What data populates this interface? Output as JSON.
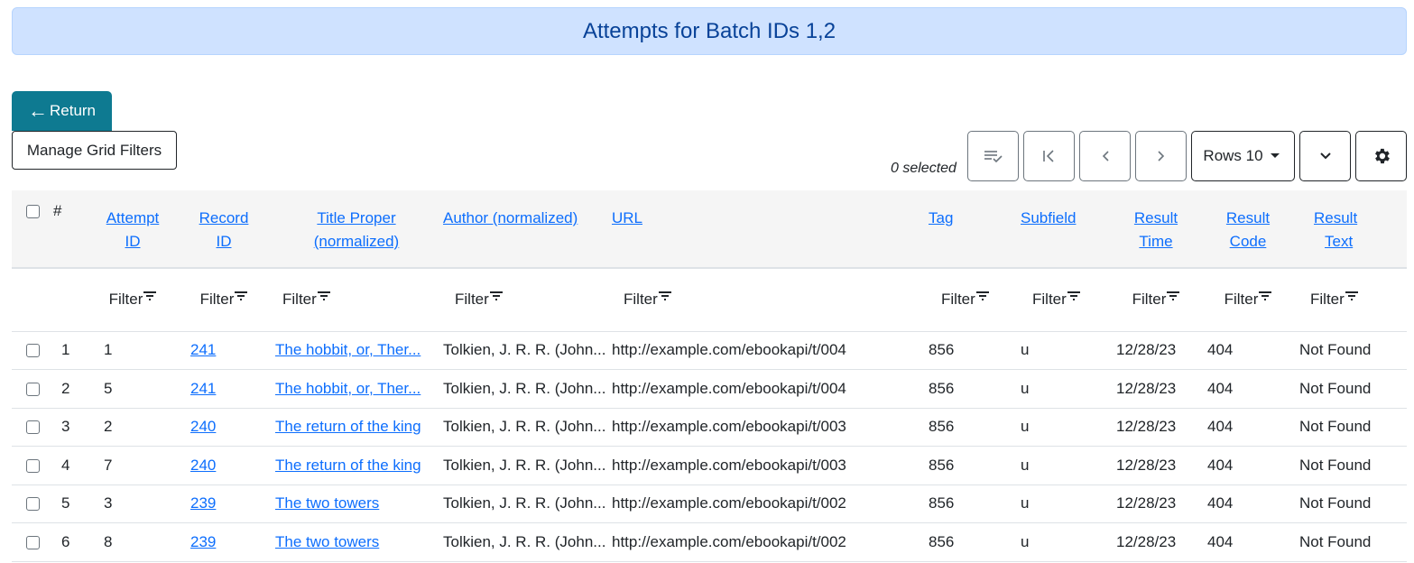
{
  "banner": {
    "title": "Attempts for Batch IDs 1,2"
  },
  "buttons": {
    "return_label": "Return",
    "return_icon": "←",
    "manage_filters_label": "Manage Grid Filters"
  },
  "toolbar": {
    "selected_text": "0 selected",
    "rows_label": "Rows 10",
    "icons": [
      "select-list-icon",
      "first-page-icon",
      "previous-page-icon",
      "next-page-icon",
      "caret-down-icon",
      "chevron-down-icon",
      "gear-icon"
    ]
  },
  "grid": {
    "hash_header": "#",
    "columns": [
      {
        "line1": "Attempt",
        "line2": "ID"
      },
      {
        "line1": "Record",
        "line2": "ID"
      },
      {
        "line1": "Title Proper",
        "line2": "(normalized)"
      },
      {
        "line1": "Author (normalized)",
        "line2": ""
      },
      {
        "line1": "URL",
        "line2": ""
      },
      {
        "line1": "Tag",
        "line2": ""
      },
      {
        "line1": "Subfield",
        "line2": ""
      },
      {
        "line1": "Result",
        "line2": "Time"
      },
      {
        "line1": "Result",
        "line2": "Code"
      },
      {
        "line1": "Result",
        "line2": "Text"
      }
    ],
    "filter_label": "Filter",
    "rows": [
      {
        "num": "1",
        "attempt_id": "1",
        "record_id": "241",
        "title": "The hobbit, or, Ther...",
        "author": "Tolkien, J. R. R. (John...",
        "url": "http://example.com/ebookapi/t/004",
        "tag": "856",
        "subfield": "u",
        "result_time": "12/28/23",
        "result_code": "404",
        "result_text": "Not Found"
      },
      {
        "num": "2",
        "attempt_id": "5",
        "record_id": "241",
        "title": "The hobbit, or, Ther...",
        "author": "Tolkien, J. R. R. (John...",
        "url": "http://example.com/ebookapi/t/004",
        "tag": "856",
        "subfield": "u",
        "result_time": "12/28/23",
        "result_code": "404",
        "result_text": "Not Found"
      },
      {
        "num": "3",
        "attempt_id": "2",
        "record_id": "240",
        "title": "The return of the king",
        "author": "Tolkien, J. R. R. (John...",
        "url": "http://example.com/ebookapi/t/003",
        "tag": "856",
        "subfield": "u",
        "result_time": "12/28/23",
        "result_code": "404",
        "result_text": "Not Found"
      },
      {
        "num": "4",
        "attempt_id": "7",
        "record_id": "240",
        "title": "The return of the king",
        "author": "Tolkien, J. R. R. (John...",
        "url": "http://example.com/ebookapi/t/003",
        "tag": "856",
        "subfield": "u",
        "result_time": "12/28/23",
        "result_code": "404",
        "result_text": "Not Found"
      },
      {
        "num": "5",
        "attempt_id": "3",
        "record_id": "239",
        "title": "The two towers",
        "author": "Tolkien, J. R. R. (John...",
        "url": "http://example.com/ebookapi/t/002",
        "tag": "856",
        "subfield": "u",
        "result_time": "12/28/23",
        "result_code": "404",
        "result_text": "Not Found"
      },
      {
        "num": "6",
        "attempt_id": "8",
        "record_id": "239",
        "title": "The two towers",
        "author": "Tolkien, J. R. R. (John...",
        "url": "http://example.com/ebookapi/t/002",
        "tag": "856",
        "subfield": "u",
        "result_time": "12/28/23",
        "result_code": "404",
        "result_text": "Not Found"
      }
    ]
  },
  "colors": {
    "banner_bg": "#cfe2ff",
    "banner_text": "#084298",
    "return_bg": "#0e7a91",
    "link": "#0d6efd",
    "header_bg": "#f5f5f5"
  }
}
